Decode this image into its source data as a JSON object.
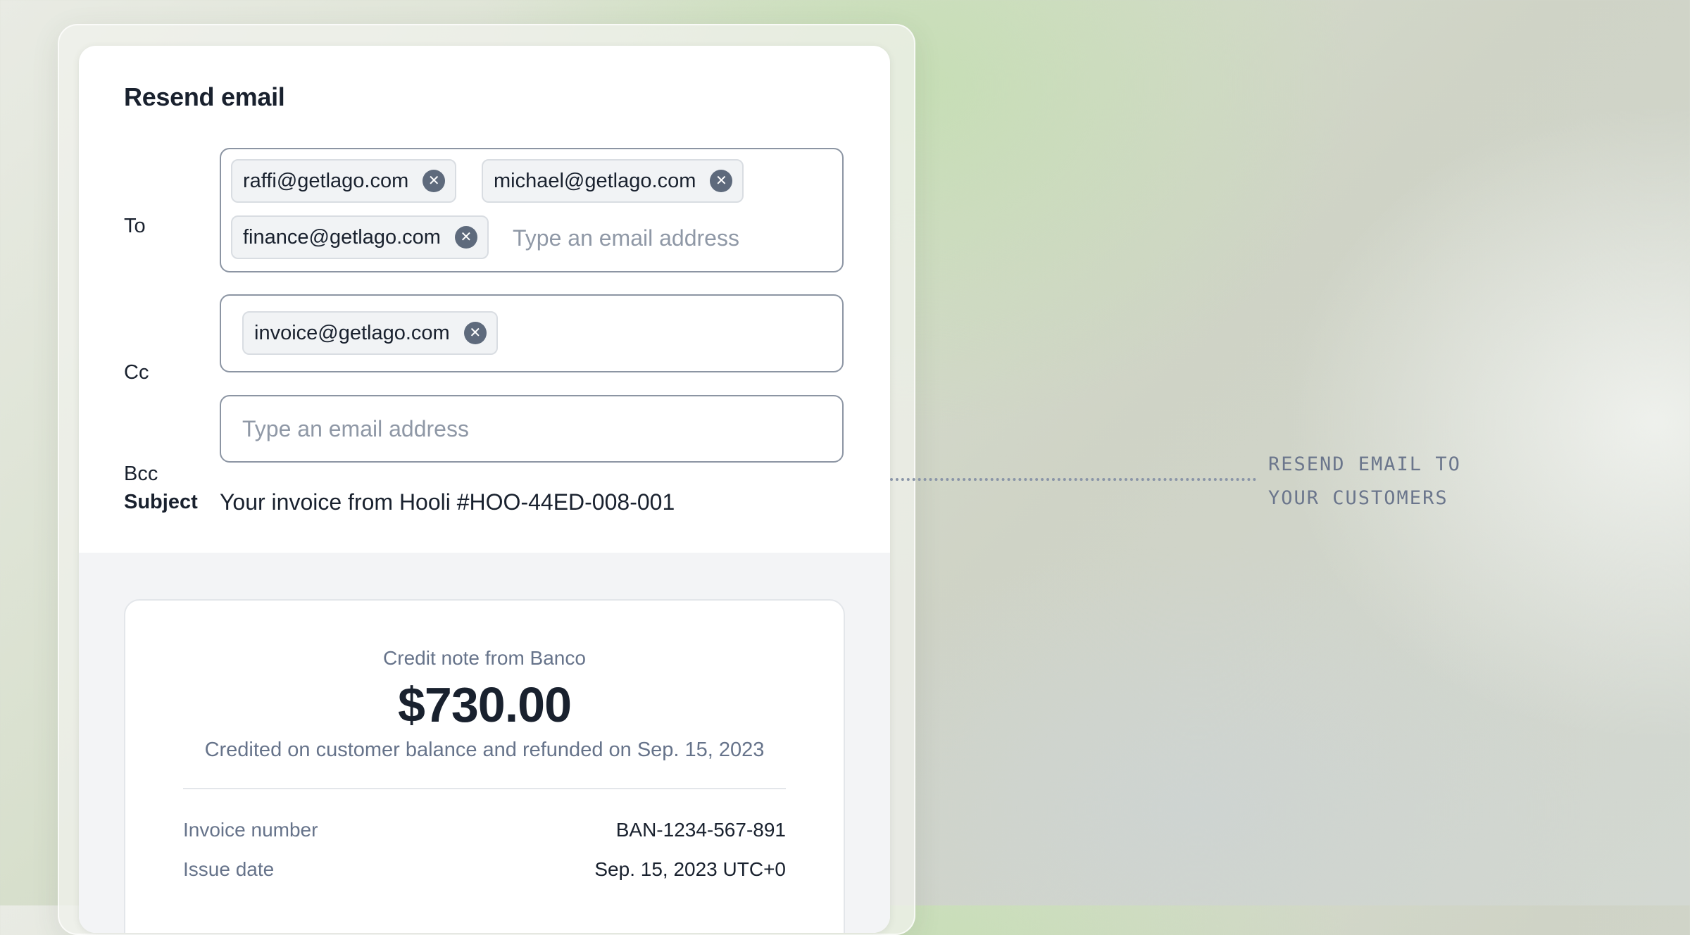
{
  "dialog": {
    "title": "Resend email",
    "to": {
      "label": "To",
      "chips": [
        "raffi@getlago.com",
        "michael@getlago.com",
        "finance@getlago.com"
      ],
      "placeholder": "Type an email address"
    },
    "cc": {
      "label": "Cc",
      "chips": [
        "invoice@getlago.com"
      ]
    },
    "bcc": {
      "label": "Bcc",
      "placeholder": "Type an email address"
    },
    "subject": {
      "label": "Subject",
      "value": "Your invoice from Hooli #HOO-44ED-008-001"
    },
    "chip_remove_glyph": "✕"
  },
  "preview": {
    "heading": "Credit note from Banco",
    "amount": "$730.00",
    "description": "Credited on customer balance and refunded on Sep. 15, 2023",
    "rows": [
      {
        "key": "Invoice number",
        "value": "BAN-1234-567-891"
      },
      {
        "key": "Issue date",
        "value": "Sep. 15, 2023 UTC+0"
      }
    ]
  },
  "annotation": {
    "line1": "RESEND EMAIL TO",
    "line2": "YOUR CUSTOMERS"
  },
  "colors": {
    "text_primary": "#19212e",
    "text_muted": "#66738a",
    "placeholder": "#8f98a6",
    "field_border": "#8c95a3",
    "chip_bg": "#f1f3f5",
    "chip_icon": "#5e6a7c"
  }
}
